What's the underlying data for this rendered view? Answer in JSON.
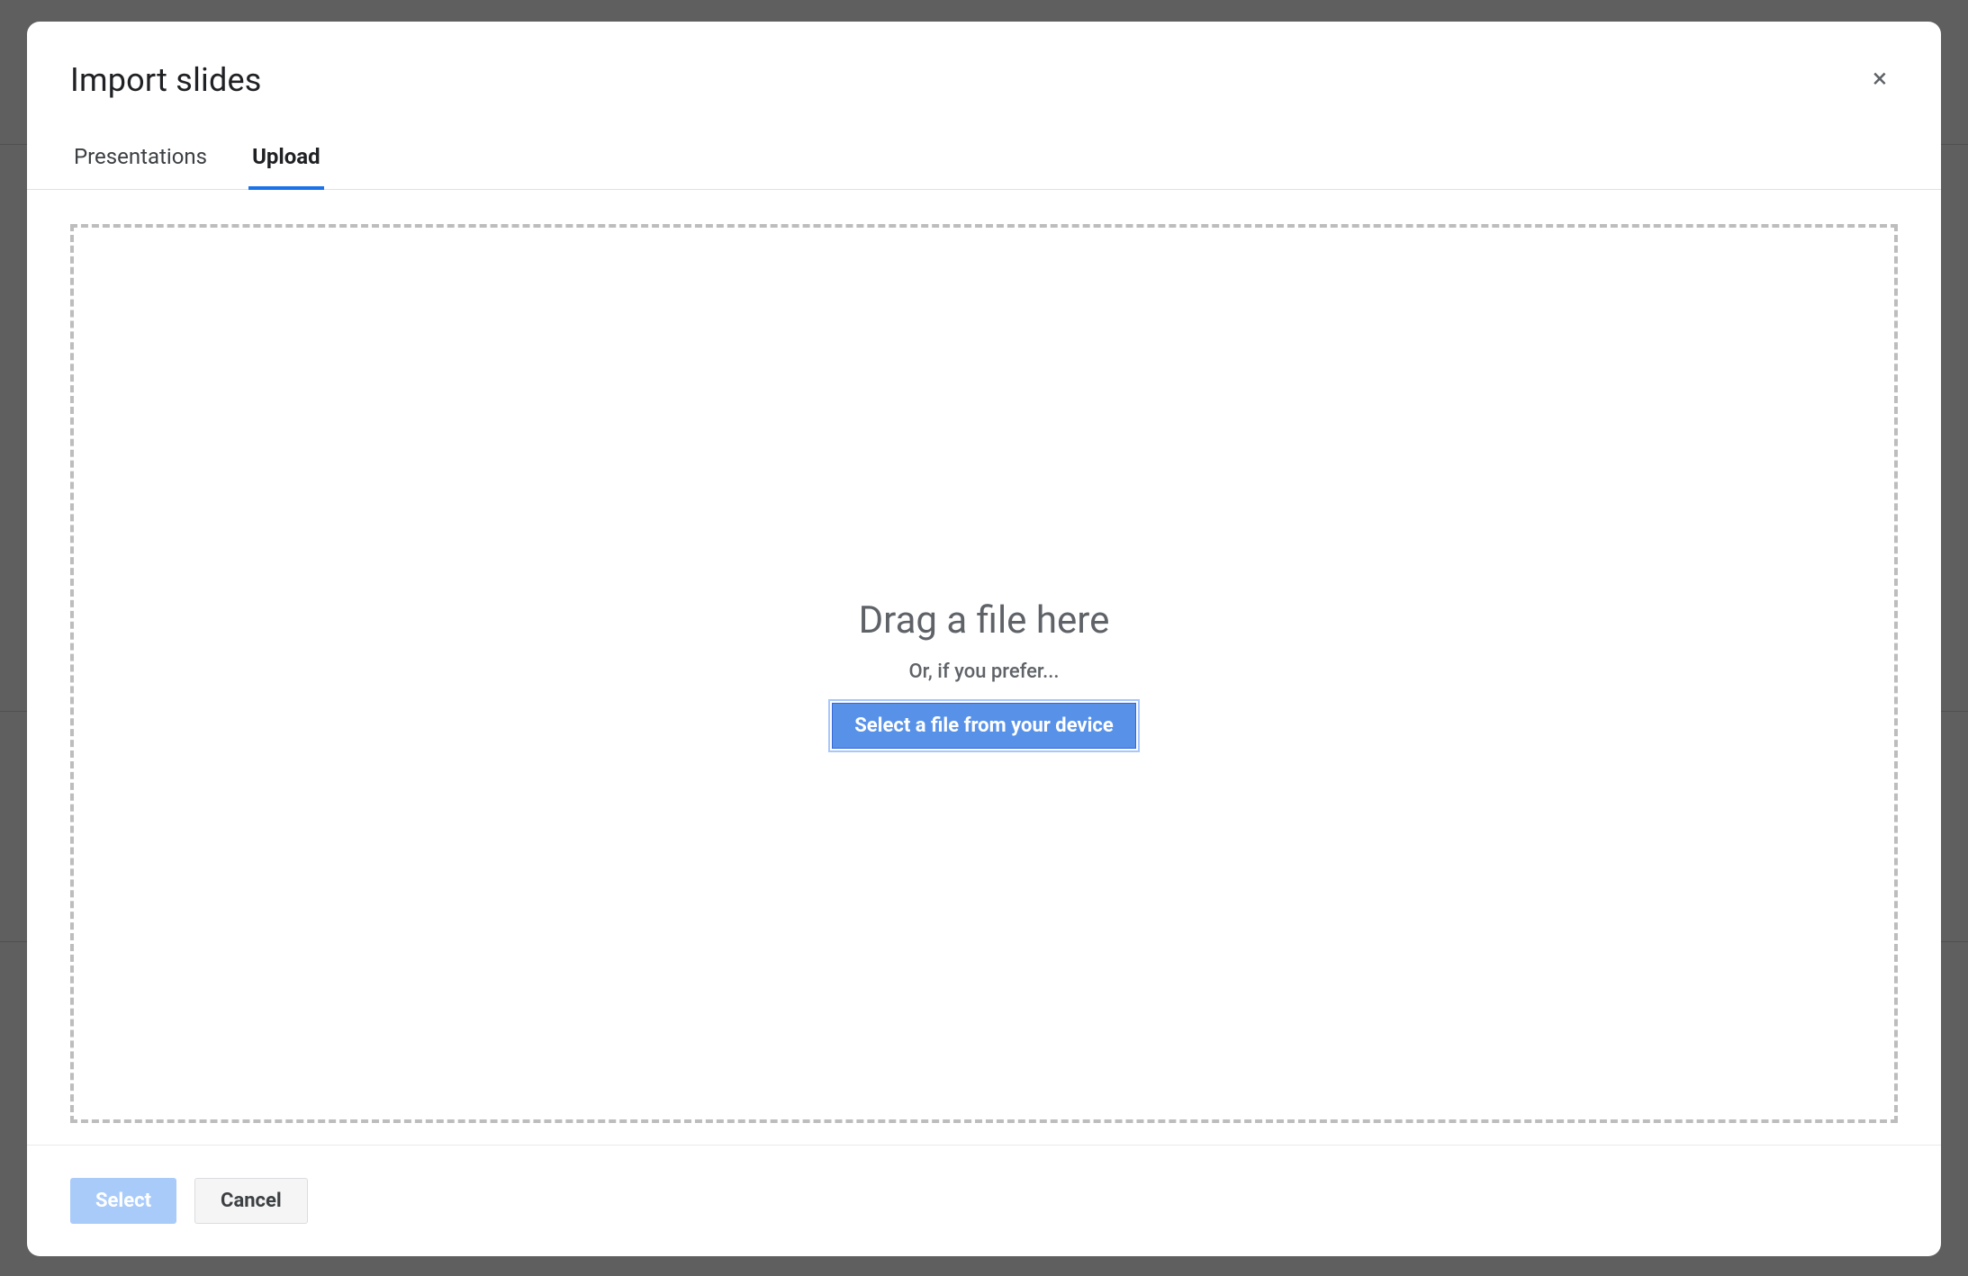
{
  "modal": {
    "title": "Import slides",
    "close_label": "×"
  },
  "tabs": {
    "presentations": "Presentations",
    "upload": "Upload"
  },
  "dropzone": {
    "title": "Drag a file here",
    "subtitle": "Or, if you prefer...",
    "select_file_button": "Select a file from your device"
  },
  "footer": {
    "select": "Select",
    "cancel": "Cancel"
  }
}
